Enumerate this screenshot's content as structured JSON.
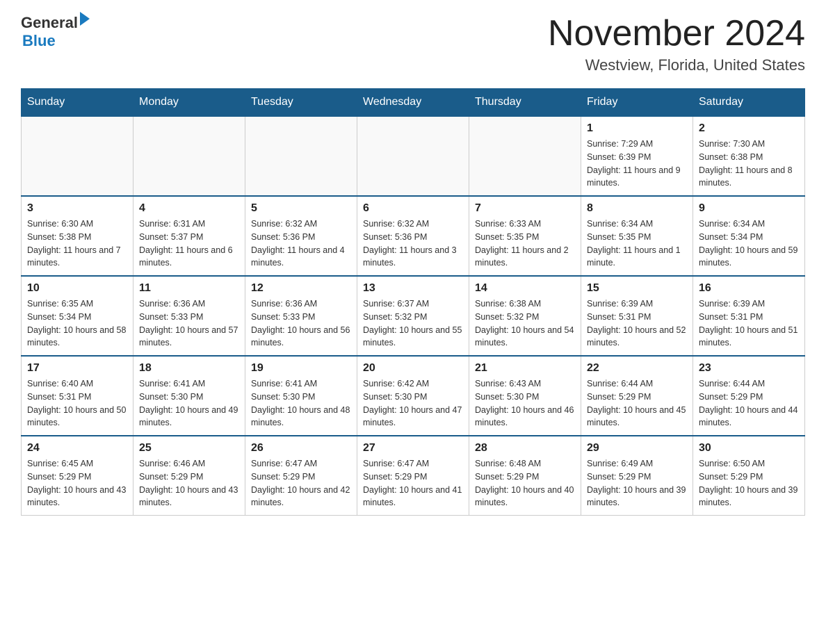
{
  "header": {
    "logo_general": "General",
    "logo_blue": "Blue",
    "title": "November 2024",
    "subtitle": "Westview, Florida, United States"
  },
  "calendar": {
    "days_of_week": [
      "Sunday",
      "Monday",
      "Tuesday",
      "Wednesday",
      "Thursday",
      "Friday",
      "Saturday"
    ],
    "weeks": [
      {
        "days": [
          {
            "number": "",
            "info": "",
            "empty": true
          },
          {
            "number": "",
            "info": "",
            "empty": true
          },
          {
            "number": "",
            "info": "",
            "empty": true
          },
          {
            "number": "",
            "info": "",
            "empty": true
          },
          {
            "number": "",
            "info": "",
            "empty": true
          },
          {
            "number": "1",
            "info": "Sunrise: 7:29 AM\nSunset: 6:39 PM\nDaylight: 11 hours and 9 minutes."
          },
          {
            "number": "2",
            "info": "Sunrise: 7:30 AM\nSunset: 6:38 PM\nDaylight: 11 hours and 8 minutes."
          }
        ]
      },
      {
        "days": [
          {
            "number": "3",
            "info": "Sunrise: 6:30 AM\nSunset: 5:38 PM\nDaylight: 11 hours and 7 minutes."
          },
          {
            "number": "4",
            "info": "Sunrise: 6:31 AM\nSunset: 5:37 PM\nDaylight: 11 hours and 6 minutes."
          },
          {
            "number": "5",
            "info": "Sunrise: 6:32 AM\nSunset: 5:36 PM\nDaylight: 11 hours and 4 minutes."
          },
          {
            "number": "6",
            "info": "Sunrise: 6:32 AM\nSunset: 5:36 PM\nDaylight: 11 hours and 3 minutes."
          },
          {
            "number": "7",
            "info": "Sunrise: 6:33 AM\nSunset: 5:35 PM\nDaylight: 11 hours and 2 minutes."
          },
          {
            "number": "8",
            "info": "Sunrise: 6:34 AM\nSunset: 5:35 PM\nDaylight: 11 hours and 1 minute."
          },
          {
            "number": "9",
            "info": "Sunrise: 6:34 AM\nSunset: 5:34 PM\nDaylight: 10 hours and 59 minutes."
          }
        ]
      },
      {
        "days": [
          {
            "number": "10",
            "info": "Sunrise: 6:35 AM\nSunset: 5:34 PM\nDaylight: 10 hours and 58 minutes."
          },
          {
            "number": "11",
            "info": "Sunrise: 6:36 AM\nSunset: 5:33 PM\nDaylight: 10 hours and 57 minutes."
          },
          {
            "number": "12",
            "info": "Sunrise: 6:36 AM\nSunset: 5:33 PM\nDaylight: 10 hours and 56 minutes."
          },
          {
            "number": "13",
            "info": "Sunrise: 6:37 AM\nSunset: 5:32 PM\nDaylight: 10 hours and 55 minutes."
          },
          {
            "number": "14",
            "info": "Sunrise: 6:38 AM\nSunset: 5:32 PM\nDaylight: 10 hours and 54 minutes."
          },
          {
            "number": "15",
            "info": "Sunrise: 6:39 AM\nSunset: 5:31 PM\nDaylight: 10 hours and 52 minutes."
          },
          {
            "number": "16",
            "info": "Sunrise: 6:39 AM\nSunset: 5:31 PM\nDaylight: 10 hours and 51 minutes."
          }
        ]
      },
      {
        "days": [
          {
            "number": "17",
            "info": "Sunrise: 6:40 AM\nSunset: 5:31 PM\nDaylight: 10 hours and 50 minutes."
          },
          {
            "number": "18",
            "info": "Sunrise: 6:41 AM\nSunset: 5:30 PM\nDaylight: 10 hours and 49 minutes."
          },
          {
            "number": "19",
            "info": "Sunrise: 6:41 AM\nSunset: 5:30 PM\nDaylight: 10 hours and 48 minutes."
          },
          {
            "number": "20",
            "info": "Sunrise: 6:42 AM\nSunset: 5:30 PM\nDaylight: 10 hours and 47 minutes."
          },
          {
            "number": "21",
            "info": "Sunrise: 6:43 AM\nSunset: 5:30 PM\nDaylight: 10 hours and 46 minutes."
          },
          {
            "number": "22",
            "info": "Sunrise: 6:44 AM\nSunset: 5:29 PM\nDaylight: 10 hours and 45 minutes."
          },
          {
            "number": "23",
            "info": "Sunrise: 6:44 AM\nSunset: 5:29 PM\nDaylight: 10 hours and 44 minutes."
          }
        ]
      },
      {
        "days": [
          {
            "number": "24",
            "info": "Sunrise: 6:45 AM\nSunset: 5:29 PM\nDaylight: 10 hours and 43 minutes."
          },
          {
            "number": "25",
            "info": "Sunrise: 6:46 AM\nSunset: 5:29 PM\nDaylight: 10 hours and 43 minutes."
          },
          {
            "number": "26",
            "info": "Sunrise: 6:47 AM\nSunset: 5:29 PM\nDaylight: 10 hours and 42 minutes."
          },
          {
            "number": "27",
            "info": "Sunrise: 6:47 AM\nSunset: 5:29 PM\nDaylight: 10 hours and 41 minutes."
          },
          {
            "number": "28",
            "info": "Sunrise: 6:48 AM\nSunset: 5:29 PM\nDaylight: 10 hours and 40 minutes."
          },
          {
            "number": "29",
            "info": "Sunrise: 6:49 AM\nSunset: 5:29 PM\nDaylight: 10 hours and 39 minutes."
          },
          {
            "number": "30",
            "info": "Sunrise: 6:50 AM\nSunset: 5:29 PM\nDaylight: 10 hours and 39 minutes."
          }
        ]
      }
    ]
  }
}
